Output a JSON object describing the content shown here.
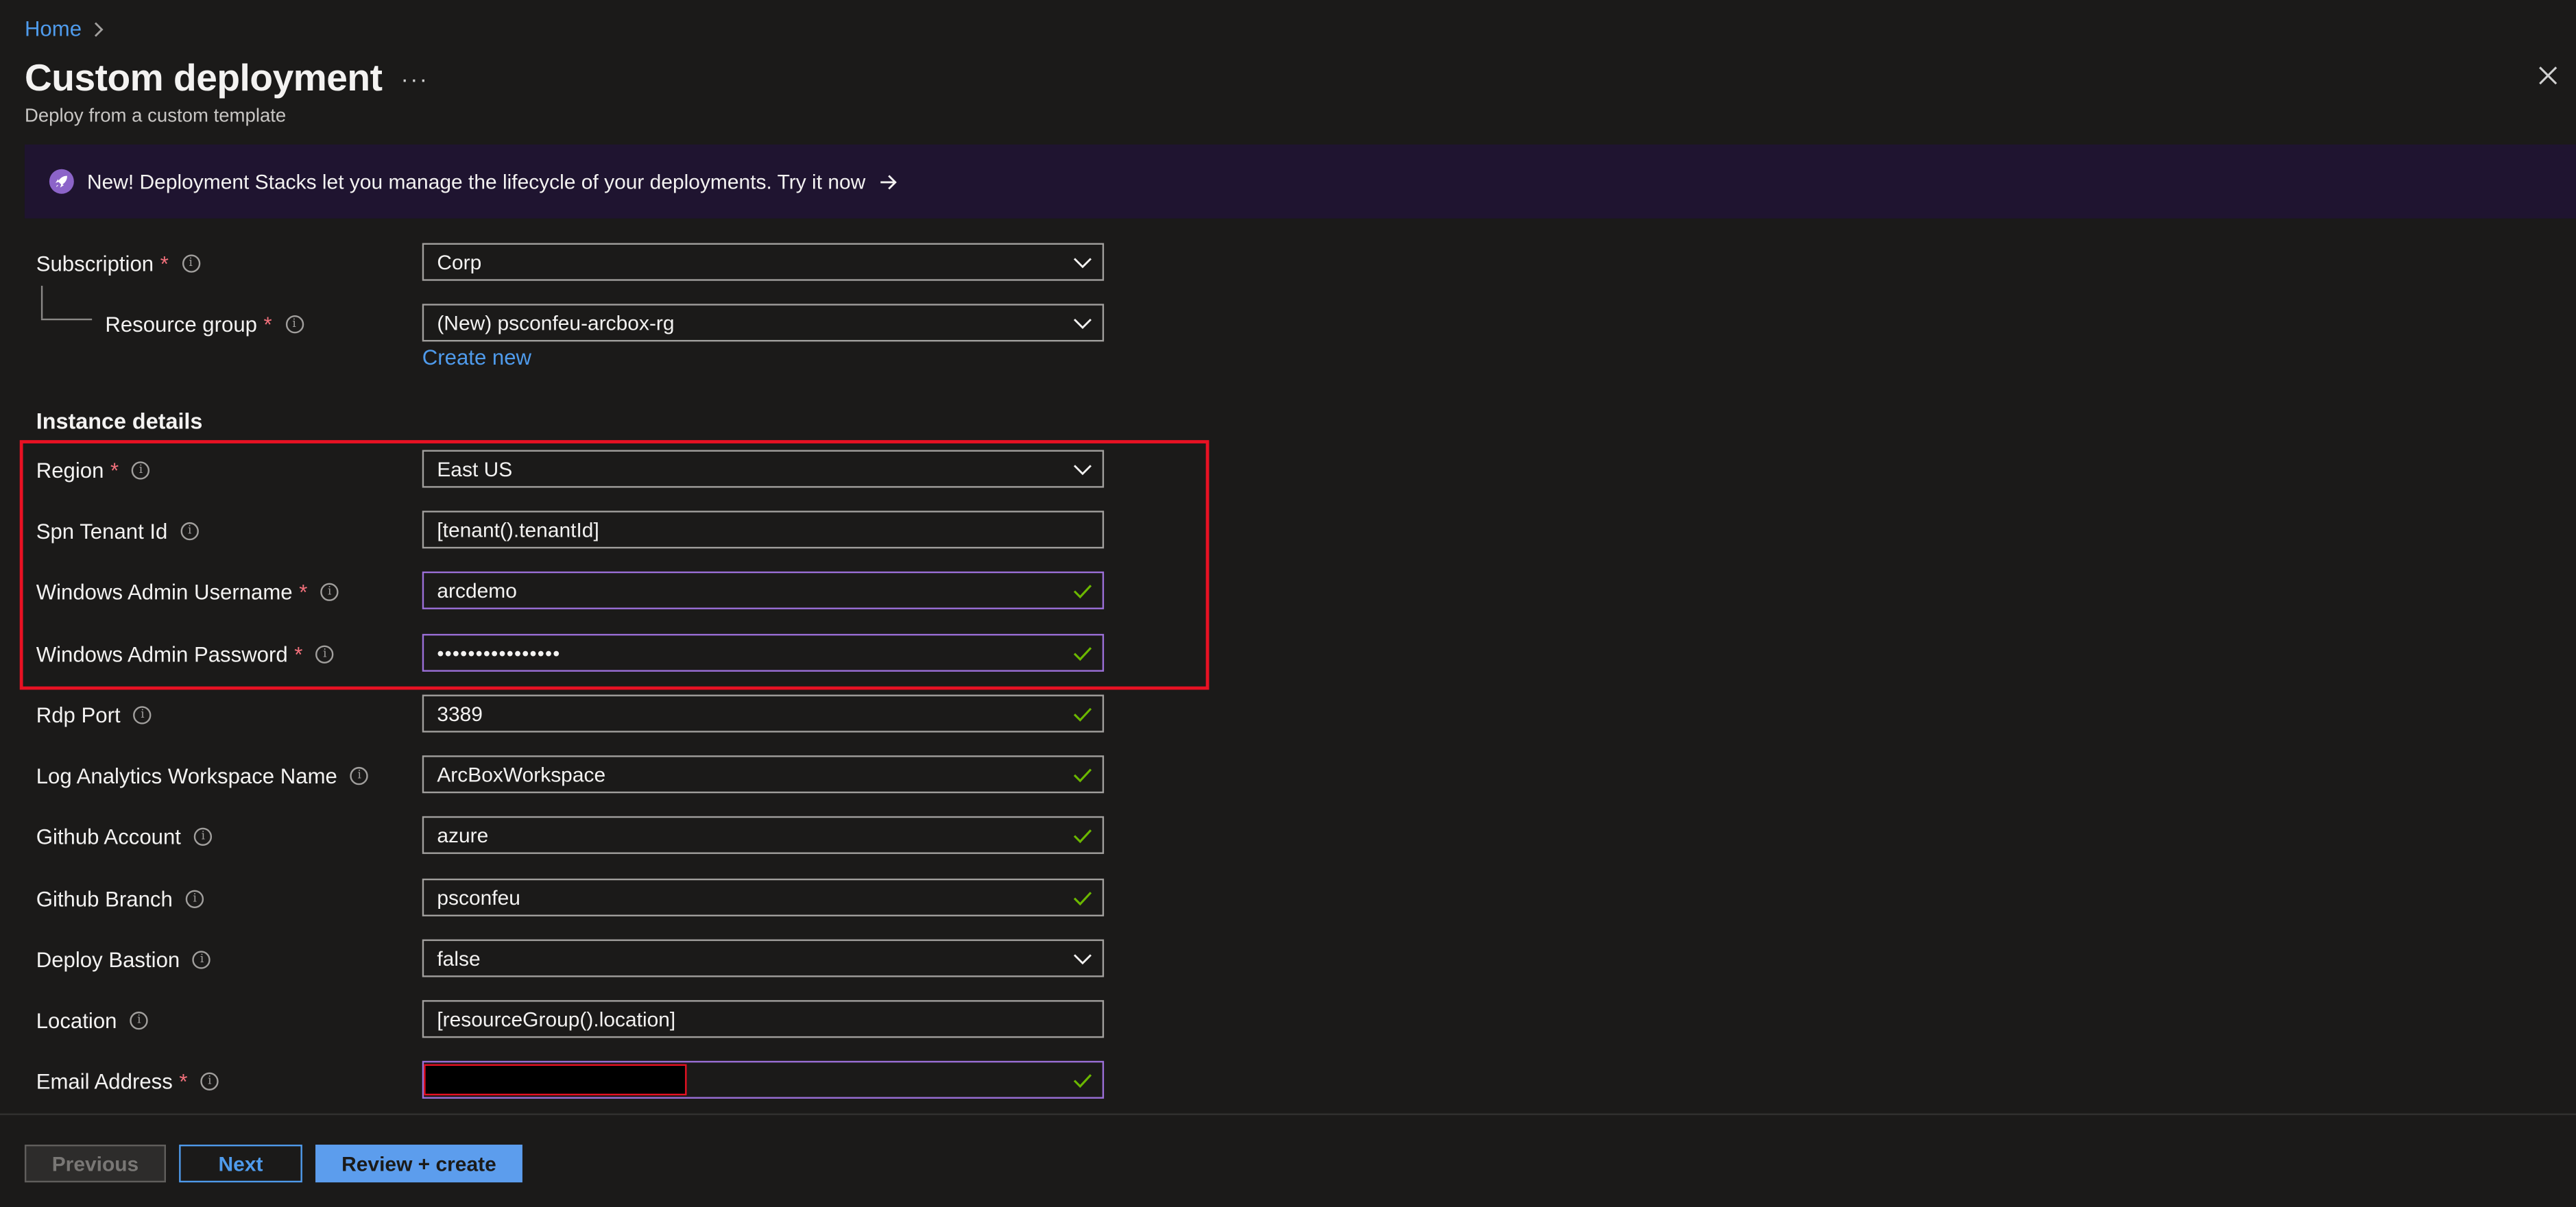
{
  "breadcrumb": {
    "home": "Home"
  },
  "header": {
    "title": "Custom deployment",
    "more": "···",
    "subtitle": "Deploy from a custom template"
  },
  "banner": {
    "text": "New! Deployment Stacks let you manage the lifecycle of your deployments. Try it now"
  },
  "project": {
    "subscription": {
      "label": "Subscription",
      "value": "Corp"
    },
    "resource_group": {
      "label": "Resource group",
      "value": "(New) psconfeu-arcbox-rg",
      "create_new": "Create new"
    }
  },
  "instance": {
    "title": "Instance details",
    "region": {
      "label": "Region",
      "value": "East US"
    },
    "spn_tenant_id": {
      "label": "Spn Tenant Id",
      "value": "[tenant().tenantId]"
    },
    "windows_admin_username": {
      "label": "Windows Admin Username",
      "value": "arcdemo"
    },
    "windows_admin_password": {
      "label": "Windows Admin Password",
      "value": "••••••••••••••••"
    },
    "rdp_port": {
      "label": "Rdp Port",
      "value": "3389"
    },
    "log_analytics_workspace_name": {
      "label": "Log Analytics Workspace Name",
      "value": "ArcBoxWorkspace"
    },
    "github_account": {
      "label": "Github Account",
      "value": "azure"
    },
    "github_branch": {
      "label": "Github Branch",
      "value": "psconfeu"
    },
    "deploy_bastion": {
      "label": "Deploy Bastion",
      "value": "false"
    },
    "location": {
      "label": "Location",
      "value": "[resourceGroup().location]"
    },
    "email_address": {
      "label": "Email Address",
      "value": ""
    }
  },
  "footer": {
    "previous": "Previous",
    "next": "Next",
    "review_create": "Review + create"
  },
  "colors": {
    "background": "#1b1a19",
    "link": "#4f9bec",
    "required": "#f1707b",
    "valid_border": "#9b6fd8",
    "check": "#6bb700",
    "highlight": "#e81123",
    "primary_button": "#5c9ded"
  },
  "icons": {
    "breadcrumb_separator": "chevron-right-icon",
    "close": "close-icon",
    "banner": "rocket-icon",
    "banner_arrow": "arrow-right-icon",
    "dropdown": "chevron-down-icon",
    "valid": "checkmark-icon",
    "info": "info-icon"
  }
}
